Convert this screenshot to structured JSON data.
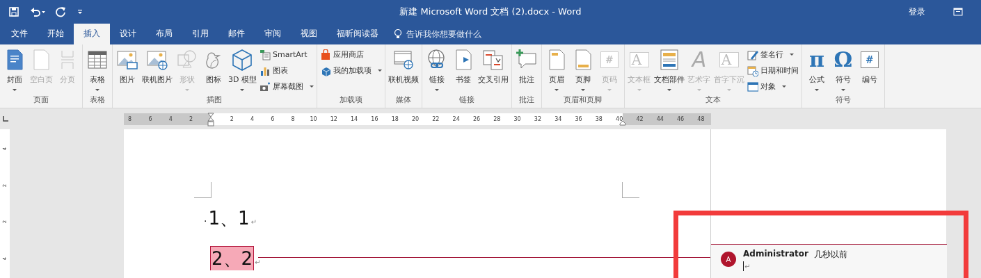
{
  "window": {
    "title": "新建 Microsoft Word 文档 (2).docx  -  Word",
    "sign_in": "登录"
  },
  "tabs": [
    {
      "label": "文件",
      "selected": false
    },
    {
      "label": "开始",
      "selected": false
    },
    {
      "label": "插入",
      "selected": true
    },
    {
      "label": "设计",
      "selected": false
    },
    {
      "label": "布局",
      "selected": false
    },
    {
      "label": "引用",
      "selected": false
    },
    {
      "label": "邮件",
      "selected": false
    },
    {
      "label": "审阅",
      "selected": false
    },
    {
      "label": "视图",
      "selected": false
    },
    {
      "label": "福昕阅读器",
      "selected": false
    }
  ],
  "tell_me": {
    "placeholder": "告诉我你想要做什么"
  },
  "ribbon_groups": [
    {
      "label": "页面",
      "items": [
        {
          "kind": "large",
          "label": "封面",
          "disabled": false,
          "dropdown": true
        },
        {
          "kind": "large",
          "label": "空白页",
          "disabled": true,
          "dropdown": false
        },
        {
          "kind": "large",
          "label": "分页",
          "disabled": true,
          "dropdown": false
        }
      ]
    },
    {
      "label": "表格",
      "items": [
        {
          "kind": "large",
          "label": "表格",
          "disabled": false,
          "dropdown": true
        }
      ]
    },
    {
      "label": "插图",
      "items": [
        {
          "kind": "large",
          "label": "图片",
          "disabled": false,
          "dropdown": false
        },
        {
          "kind": "large",
          "label": "联机图片",
          "disabled": false,
          "dropdown": false
        },
        {
          "kind": "large",
          "label": "形状",
          "disabled": true,
          "dropdown": true
        },
        {
          "kind": "large",
          "label": "图标",
          "disabled": false,
          "dropdown": false
        },
        {
          "kind": "large",
          "label": "3D 模型",
          "disabled": false,
          "dropdown": true
        },
        {
          "kind": "small",
          "label": "SmartArt",
          "disabled": false,
          "dropdown": false
        },
        {
          "kind": "small",
          "label": "图表",
          "disabled": false,
          "dropdown": false
        },
        {
          "kind": "small",
          "label": "屏幕截图",
          "disabled": false,
          "dropdown": true
        }
      ]
    },
    {
      "label": "加载项",
      "items": [
        {
          "kind": "small",
          "label": "应用商店",
          "disabled": false,
          "dropdown": false
        },
        {
          "kind": "small",
          "label": "我的加载项",
          "disabled": false,
          "dropdown": true
        }
      ]
    },
    {
      "label": "媒体",
      "items": [
        {
          "kind": "large",
          "label": "联机视频",
          "disabled": false,
          "dropdown": false
        }
      ]
    },
    {
      "label": "链接",
      "items": [
        {
          "kind": "large",
          "label": "链接",
          "disabled": false,
          "dropdown": true
        },
        {
          "kind": "large",
          "label": "书签",
          "disabled": false,
          "dropdown": false
        },
        {
          "kind": "large",
          "label": "交叉引用",
          "disabled": false,
          "dropdown": false
        }
      ]
    },
    {
      "label": "批注",
      "items": [
        {
          "kind": "large",
          "label": "批注",
          "disabled": false,
          "dropdown": false
        }
      ]
    },
    {
      "label": "页眉和页脚",
      "items": [
        {
          "kind": "large",
          "label": "页眉",
          "disabled": false,
          "dropdown": true
        },
        {
          "kind": "large",
          "label": "页脚",
          "disabled": false,
          "dropdown": true
        },
        {
          "kind": "large",
          "label": "页码",
          "disabled": true,
          "dropdown": true,
          "glyph": "#"
        }
      ]
    },
    {
      "label": "文本",
      "items": [
        {
          "kind": "large",
          "label": "文本框",
          "disabled": true,
          "dropdown": true,
          "glyph": "A"
        },
        {
          "kind": "large",
          "label": "文档部件",
          "disabled": false,
          "dropdown": true
        },
        {
          "kind": "large",
          "label": "艺术字",
          "disabled": true,
          "dropdown": true,
          "glyph": "A"
        },
        {
          "kind": "large",
          "label": "首字下沉",
          "disabled": true,
          "dropdown": true,
          "glyph": "A"
        },
        {
          "kind": "small",
          "label": "签名行",
          "disabled": false,
          "dropdown": true
        },
        {
          "kind": "small",
          "label": "日期和时间",
          "disabled": false,
          "dropdown": false
        },
        {
          "kind": "small",
          "label": "对象",
          "disabled": false,
          "dropdown": true
        }
      ]
    },
    {
      "label": "符号",
      "items": [
        {
          "kind": "large",
          "label": "公式",
          "disabled": false,
          "dropdown": true,
          "glyph": "π"
        },
        {
          "kind": "large",
          "label": "符号",
          "disabled": false,
          "dropdown": true,
          "glyph": "Ω"
        },
        {
          "kind": "large",
          "label": "编号",
          "disabled": false,
          "dropdown": false,
          "glyph": "#"
        }
      ]
    }
  ],
  "ruler": {
    "left_labels": [
      "8",
      "6",
      "4",
      "2"
    ],
    "right_labels": [
      "2",
      "4",
      "6",
      "8",
      "10",
      "12",
      "14",
      "16",
      "18",
      "20",
      "22",
      "24",
      "26",
      "28",
      "30",
      "32",
      "34",
      "36",
      "38",
      "40",
      "42",
      "44",
      "46",
      "48"
    ]
  },
  "vertical_ruler": {
    "labels": [
      "4",
      "2",
      "2",
      "4"
    ]
  },
  "document": {
    "paragraphs": [
      {
        "lead": "·",
        "text": "1、1",
        "end_mark": "↵",
        "commented": false
      },
      {
        "text": "2、2",
        "end_mark": "↵",
        "commented": true
      }
    ]
  },
  "comment": {
    "initial": "A",
    "author": "Administrator",
    "time": "几秒以前",
    "end_mark": "↵"
  }
}
